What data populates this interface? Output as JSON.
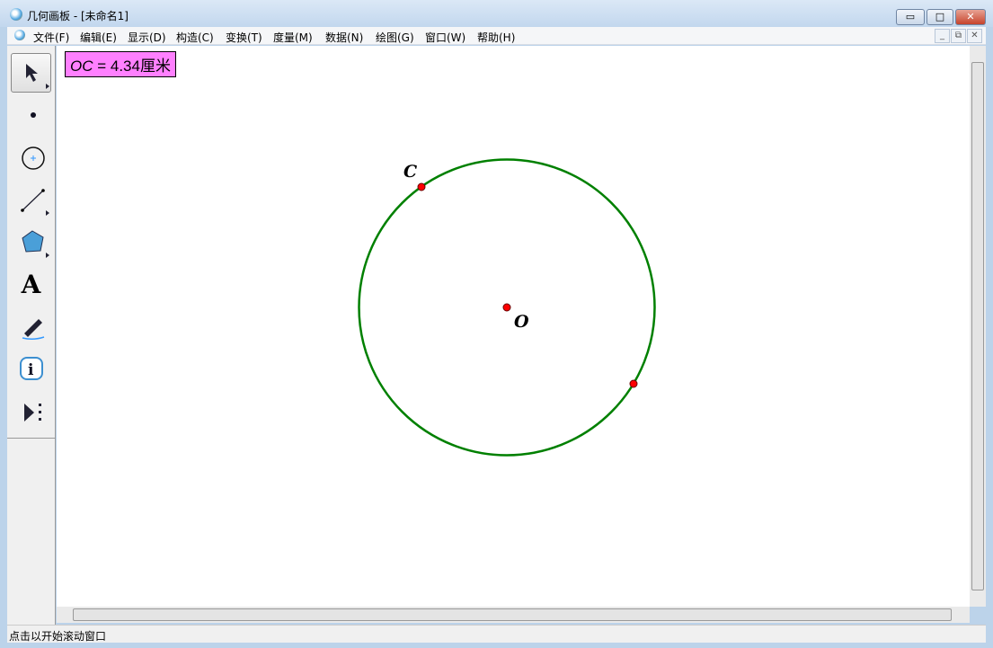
{
  "window": {
    "title": "几何画板 - [未命名1]",
    "min": "▭",
    "max": "□",
    "close": "✕"
  },
  "menu": [
    "文件(F)",
    "编辑(E)",
    "显示(D)",
    "构造(C)",
    "变换(T)",
    "度量(M)",
    "数据(N)",
    "绘图(G)",
    "窗口(W)",
    "帮助(H)"
  ],
  "mdi": {
    "min": "_",
    "restore": "⧉",
    "close": "✕"
  },
  "tools": [
    "selection-arrow",
    "point",
    "compass",
    "straightedge",
    "polygon",
    "text",
    "marker",
    "information",
    "custom-tools"
  ],
  "text_tool_glyph": "A",
  "measurement": {
    "var": "OC",
    "rest": " = 4.34厘米"
  },
  "labels": {
    "c": "C",
    "o": "O"
  },
  "colors": {
    "circle": "#008000",
    "point": "#ff0000",
    "measure_bg": "#ff80ff"
  },
  "status": "点击以开始滚动窗口"
}
